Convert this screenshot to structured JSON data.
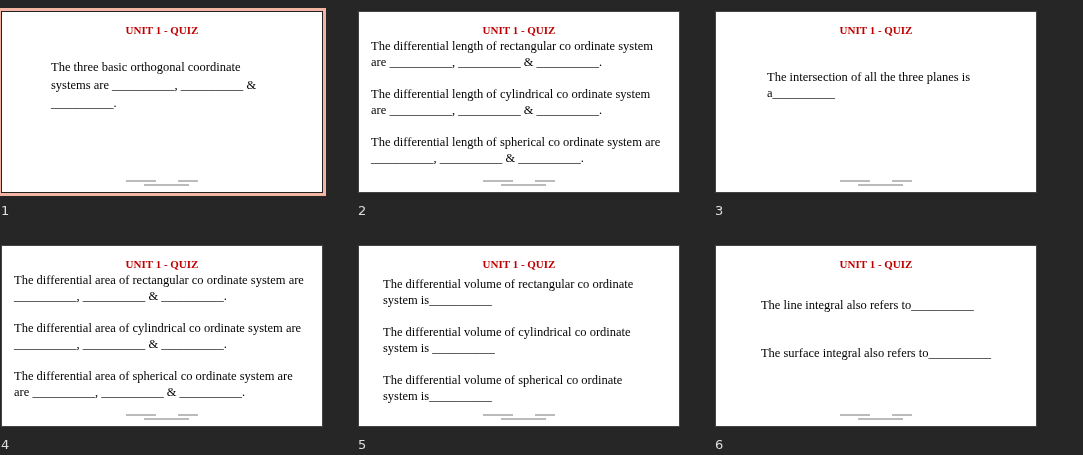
{
  "slides": [
    {
      "number": "1",
      "selected": true,
      "kind": "intro",
      "title": "UNIT 1 - QUIZ",
      "paragraphs": [
        "The three basic orthogonal coordinate systems are __________, __________ & __________."
      ]
    },
    {
      "number": "2",
      "selected": false,
      "kind": "list",
      "title": "UNIT 1 - QUIZ",
      "paragraphs": [
        "The differential length of rectangular co ordinate system are __________, __________ & __________.",
        "The differential length of cylindrical  co ordinate system are __________, __________ & __________.",
        "The differential length of spherical co ordinate system are __________, __________ & __________."
      ]
    },
    {
      "number": "3",
      "selected": false,
      "kind": "single",
      "title": "UNIT 1 - QUIZ",
      "paragraphs": [
        "The intersection of all the three planes is a__________"
      ]
    },
    {
      "number": "4",
      "selected": false,
      "kind": "list",
      "title": "UNIT 1 - QUIZ",
      "paragraphs": [
        "The differential area of rectangular co ordinate system are __________, __________ & __________.",
        "The differential area of cylindrical co ordinate system are __________, __________ & __________.",
        "The differential area of spherical co ordinate system are are __________, __________ & __________."
      ]
    },
    {
      "number": "5",
      "selected": false,
      "kind": "narrow",
      "title": "UNIT 1 - QUIZ",
      "paragraphs": [
        "The differential volume of rectangular co ordinate system is__________",
        "The differential volume of cylindrical co ordinate system is __________",
        "The differential volume of spherical co ordinate system is__________"
      ]
    },
    {
      "number": "6",
      "selected": false,
      "kind": "pair",
      "title": "UNIT 1 - QUIZ",
      "paragraphs": [
        "The line integral also refers to__________",
        "The surface integral also refers to__________"
      ]
    }
  ]
}
